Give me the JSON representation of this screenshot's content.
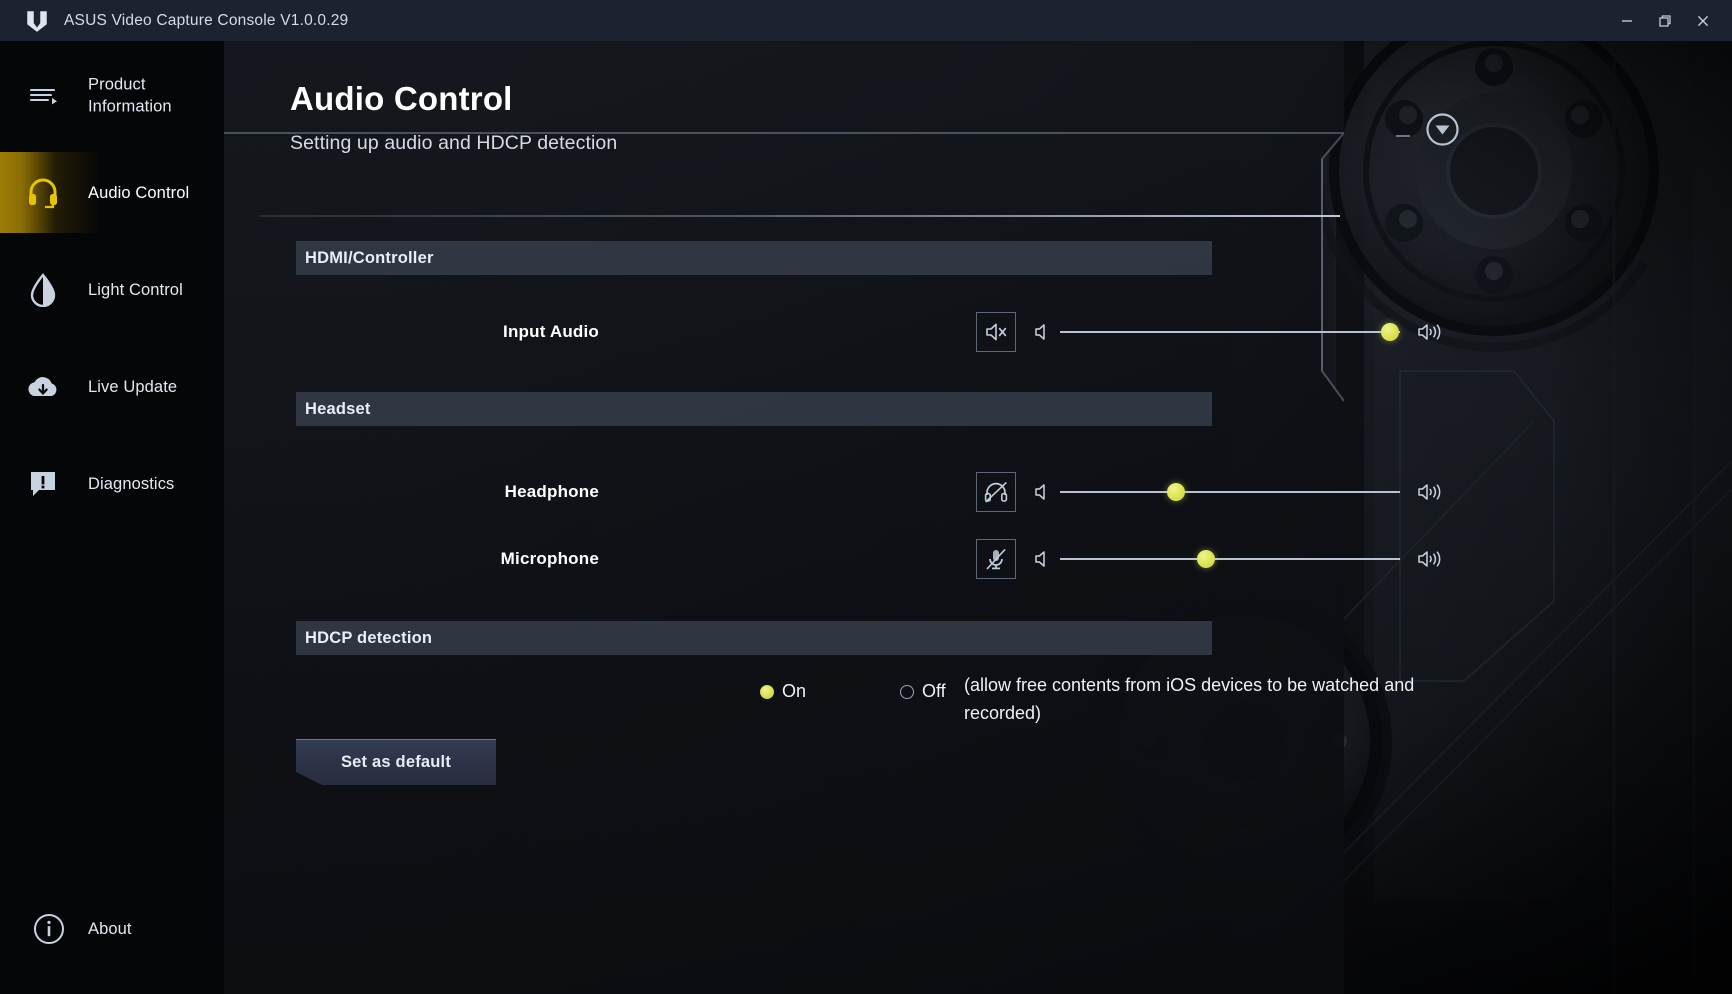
{
  "window": {
    "title": "ASUS Video Capture Console V1.0.0.29",
    "logo_icon": "tuf-shield-logo",
    "controls": [
      {
        "name": "minimize-button",
        "icon": "minimize-icon"
      },
      {
        "name": "restore-button",
        "icon": "restore-icon"
      },
      {
        "name": "close-button",
        "icon": "close-icon"
      }
    ]
  },
  "sidebar": {
    "items": [
      {
        "label": "Product Information",
        "icon": "menu-list-icon",
        "active": false
      },
      {
        "label": "Audio Control",
        "icon": "headset-icon",
        "active": true
      },
      {
        "label": "Light Control",
        "icon": "droplet-contrast-icon",
        "active": false
      },
      {
        "label": "Live Update",
        "icon": "cloud-download-icon",
        "active": false
      },
      {
        "label": "Diagnostics",
        "icon": "alert-chat-icon",
        "active": false
      }
    ],
    "about": {
      "label": "About",
      "icon": "info-circle-icon"
    },
    "active_accent": "#8a6d05"
  },
  "header": {
    "title": "Audio Control",
    "subtitle": "Setting up audio and HDCP detection",
    "collapse_icon": "chevron-down-circle-icon",
    "dash_icon": "minus-icon"
  },
  "sections": {
    "hdmi": {
      "title": "HDMI/Controller",
      "rows": [
        {
          "label": "Input Audio",
          "mute_icon": "speaker-mute-icon",
          "low_icon": "speaker-low-icon",
          "high_icon": "speaker-high-icon",
          "value": 97
        }
      ]
    },
    "headset": {
      "title": "Headset",
      "rows": [
        {
          "label": "Headphone",
          "mute_icon": "headphone-slash-icon",
          "low_icon": "speaker-low-icon",
          "high_icon": "speaker-high-icon",
          "value": 34
        },
        {
          "label": "Microphone",
          "mute_icon": "microphone-slash-icon",
          "low_icon": "speaker-low-icon",
          "high_icon": "speaker-high-icon",
          "value": 43
        }
      ]
    },
    "hdcp": {
      "title": "HDCP detection",
      "option_on": "On",
      "option_off": "Off",
      "selected": "On",
      "note": "(allow free contents from iOS devices to be watched and recorded)"
    }
  },
  "buttons": {
    "set_as_default": "Set as default"
  },
  "colors": {
    "accent_yellow": "#dde45a",
    "sidebar_gold": "#e8c400",
    "titlebar": "#1c2230",
    "section_bar": "#343b48",
    "button_fill": "#2b3346"
  }
}
